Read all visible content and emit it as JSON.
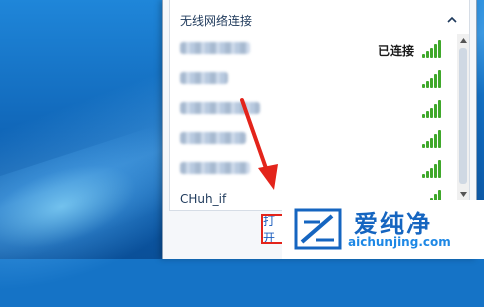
{
  "popup": {
    "section_title": "无线网络连接",
    "networks": [
      {
        "name": "████ ████",
        "status": "已连接",
        "signal_bars": 5
      },
      {
        "name": "███ ███",
        "status": "",
        "signal_bars": 5
      },
      {
        "name": "███████ ███",
        "status": "",
        "signal_bars": 5
      },
      {
        "name": "██████ ████",
        "status": "",
        "signal_bars": 5
      },
      {
        "name": "██████ ████",
        "status": "",
        "signal_bars": 5
      },
      {
        "name": "CHuh_if",
        "status": "",
        "signal_bars": 5
      }
    ],
    "footer_link": "打开网络和共享中心",
    "footer_visible": "打开"
  },
  "watermark": {
    "brand": "爱纯净",
    "url": "aichunjing.com"
  },
  "colors": {
    "signal": "#3fa82a",
    "highlight_border": "#e3241b",
    "arrow": "#e3241b",
    "brand": "#1565c0"
  }
}
